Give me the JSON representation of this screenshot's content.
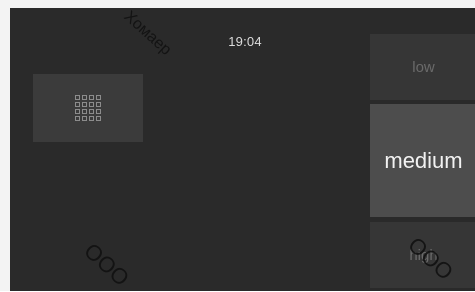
{
  "status_bar": {
    "time": "19:04"
  },
  "menu_button": {
    "icon": "grid-icon"
  },
  "speed_levels": [
    {
      "label": "low",
      "selected": false
    },
    {
      "label": "medium",
      "selected": true
    },
    {
      "label": "high",
      "selected": false
    }
  ],
  "watermark": {
    "top_text": "Хомаер",
    "bottom_left_text": "ООО",
    "bottom_right_text": "ООО"
  },
  "colors": {
    "screen_bg": "#2a2a2a",
    "button_bg": "#363636",
    "selected_bg": "#4d4d4d",
    "text": "#dcdcdc"
  }
}
